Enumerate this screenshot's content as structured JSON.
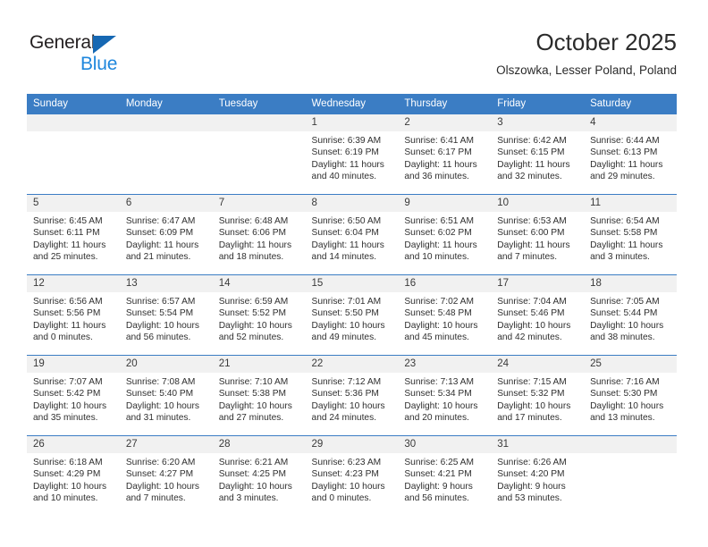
{
  "brand": {
    "name_part1": "General",
    "name_part2": "Blue",
    "triangle_color": "#1668b3",
    "blue_color": "#1f87dd",
    "dark_color": "#231f20"
  },
  "header": {
    "title": "October 2025",
    "subtitle": "Olszowka, Lesser Poland, Poland"
  },
  "theme": {
    "header_blue": "#3b7dc4",
    "daynum_band": "#f1f1f1",
    "text": "#2f2f2f"
  },
  "weekday_headers": [
    "Sunday",
    "Monday",
    "Tuesday",
    "Wednesday",
    "Thursday",
    "Friday",
    "Saturday"
  ],
  "weeks": [
    [
      {
        "day": "",
        "sunrise": "",
        "sunset": "",
        "daylight1": "",
        "daylight2": "",
        "empty": true
      },
      {
        "day": "",
        "sunrise": "",
        "sunset": "",
        "daylight1": "",
        "daylight2": "",
        "empty": true
      },
      {
        "day": "",
        "sunrise": "",
        "sunset": "",
        "daylight1": "",
        "daylight2": "",
        "empty": true
      },
      {
        "day": "1",
        "sunrise": "Sunrise: 6:39 AM",
        "sunset": "Sunset: 6:19 PM",
        "daylight1": "Daylight: 11 hours",
        "daylight2": "and 40 minutes.",
        "empty": false
      },
      {
        "day": "2",
        "sunrise": "Sunrise: 6:41 AM",
        "sunset": "Sunset: 6:17 PM",
        "daylight1": "Daylight: 11 hours",
        "daylight2": "and 36 minutes.",
        "empty": false
      },
      {
        "day": "3",
        "sunrise": "Sunrise: 6:42 AM",
        "sunset": "Sunset: 6:15 PM",
        "daylight1": "Daylight: 11 hours",
        "daylight2": "and 32 minutes.",
        "empty": false
      },
      {
        "day": "4",
        "sunrise": "Sunrise: 6:44 AM",
        "sunset": "Sunset: 6:13 PM",
        "daylight1": "Daylight: 11 hours",
        "daylight2": "and 29 minutes.",
        "empty": false
      }
    ],
    [
      {
        "day": "5",
        "sunrise": "Sunrise: 6:45 AM",
        "sunset": "Sunset: 6:11 PM",
        "daylight1": "Daylight: 11 hours",
        "daylight2": "and 25 minutes.",
        "empty": false
      },
      {
        "day": "6",
        "sunrise": "Sunrise: 6:47 AM",
        "sunset": "Sunset: 6:09 PM",
        "daylight1": "Daylight: 11 hours",
        "daylight2": "and 21 minutes.",
        "empty": false
      },
      {
        "day": "7",
        "sunrise": "Sunrise: 6:48 AM",
        "sunset": "Sunset: 6:06 PM",
        "daylight1": "Daylight: 11 hours",
        "daylight2": "and 18 minutes.",
        "empty": false
      },
      {
        "day": "8",
        "sunrise": "Sunrise: 6:50 AM",
        "sunset": "Sunset: 6:04 PM",
        "daylight1": "Daylight: 11 hours",
        "daylight2": "and 14 minutes.",
        "empty": false
      },
      {
        "day": "9",
        "sunrise": "Sunrise: 6:51 AM",
        "sunset": "Sunset: 6:02 PM",
        "daylight1": "Daylight: 11 hours",
        "daylight2": "and 10 minutes.",
        "empty": false
      },
      {
        "day": "10",
        "sunrise": "Sunrise: 6:53 AM",
        "sunset": "Sunset: 6:00 PM",
        "daylight1": "Daylight: 11 hours",
        "daylight2": "and 7 minutes.",
        "empty": false
      },
      {
        "day": "11",
        "sunrise": "Sunrise: 6:54 AM",
        "sunset": "Sunset: 5:58 PM",
        "daylight1": "Daylight: 11 hours",
        "daylight2": "and 3 minutes.",
        "empty": false
      }
    ],
    [
      {
        "day": "12",
        "sunrise": "Sunrise: 6:56 AM",
        "sunset": "Sunset: 5:56 PM",
        "daylight1": "Daylight: 11 hours",
        "daylight2": "and 0 minutes.",
        "empty": false
      },
      {
        "day": "13",
        "sunrise": "Sunrise: 6:57 AM",
        "sunset": "Sunset: 5:54 PM",
        "daylight1": "Daylight: 10 hours",
        "daylight2": "and 56 minutes.",
        "empty": false
      },
      {
        "day": "14",
        "sunrise": "Sunrise: 6:59 AM",
        "sunset": "Sunset: 5:52 PM",
        "daylight1": "Daylight: 10 hours",
        "daylight2": "and 52 minutes.",
        "empty": false
      },
      {
        "day": "15",
        "sunrise": "Sunrise: 7:01 AM",
        "sunset": "Sunset: 5:50 PM",
        "daylight1": "Daylight: 10 hours",
        "daylight2": "and 49 minutes.",
        "empty": false
      },
      {
        "day": "16",
        "sunrise": "Sunrise: 7:02 AM",
        "sunset": "Sunset: 5:48 PM",
        "daylight1": "Daylight: 10 hours",
        "daylight2": "and 45 minutes.",
        "empty": false
      },
      {
        "day": "17",
        "sunrise": "Sunrise: 7:04 AM",
        "sunset": "Sunset: 5:46 PM",
        "daylight1": "Daylight: 10 hours",
        "daylight2": "and 42 minutes.",
        "empty": false
      },
      {
        "day": "18",
        "sunrise": "Sunrise: 7:05 AM",
        "sunset": "Sunset: 5:44 PM",
        "daylight1": "Daylight: 10 hours",
        "daylight2": "and 38 minutes.",
        "empty": false
      }
    ],
    [
      {
        "day": "19",
        "sunrise": "Sunrise: 7:07 AM",
        "sunset": "Sunset: 5:42 PM",
        "daylight1": "Daylight: 10 hours",
        "daylight2": "and 35 minutes.",
        "empty": false
      },
      {
        "day": "20",
        "sunrise": "Sunrise: 7:08 AM",
        "sunset": "Sunset: 5:40 PM",
        "daylight1": "Daylight: 10 hours",
        "daylight2": "and 31 minutes.",
        "empty": false
      },
      {
        "day": "21",
        "sunrise": "Sunrise: 7:10 AM",
        "sunset": "Sunset: 5:38 PM",
        "daylight1": "Daylight: 10 hours",
        "daylight2": "and 27 minutes.",
        "empty": false
      },
      {
        "day": "22",
        "sunrise": "Sunrise: 7:12 AM",
        "sunset": "Sunset: 5:36 PM",
        "daylight1": "Daylight: 10 hours",
        "daylight2": "and 24 minutes.",
        "empty": false
      },
      {
        "day": "23",
        "sunrise": "Sunrise: 7:13 AM",
        "sunset": "Sunset: 5:34 PM",
        "daylight1": "Daylight: 10 hours",
        "daylight2": "and 20 minutes.",
        "empty": false
      },
      {
        "day": "24",
        "sunrise": "Sunrise: 7:15 AM",
        "sunset": "Sunset: 5:32 PM",
        "daylight1": "Daylight: 10 hours",
        "daylight2": "and 17 minutes.",
        "empty": false
      },
      {
        "day": "25",
        "sunrise": "Sunrise: 7:16 AM",
        "sunset": "Sunset: 5:30 PM",
        "daylight1": "Daylight: 10 hours",
        "daylight2": "and 13 minutes.",
        "empty": false
      }
    ],
    [
      {
        "day": "26",
        "sunrise": "Sunrise: 6:18 AM",
        "sunset": "Sunset: 4:29 PM",
        "daylight1": "Daylight: 10 hours",
        "daylight2": "and 10 minutes.",
        "empty": false
      },
      {
        "day": "27",
        "sunrise": "Sunrise: 6:20 AM",
        "sunset": "Sunset: 4:27 PM",
        "daylight1": "Daylight: 10 hours",
        "daylight2": "and 7 minutes.",
        "empty": false
      },
      {
        "day": "28",
        "sunrise": "Sunrise: 6:21 AM",
        "sunset": "Sunset: 4:25 PM",
        "daylight1": "Daylight: 10 hours",
        "daylight2": "and 3 minutes.",
        "empty": false
      },
      {
        "day": "29",
        "sunrise": "Sunrise: 6:23 AM",
        "sunset": "Sunset: 4:23 PM",
        "daylight1": "Daylight: 10 hours",
        "daylight2": "and 0 minutes.",
        "empty": false
      },
      {
        "day": "30",
        "sunrise": "Sunrise: 6:25 AM",
        "sunset": "Sunset: 4:21 PM",
        "daylight1": "Daylight: 9 hours",
        "daylight2": "and 56 minutes.",
        "empty": false
      },
      {
        "day": "31",
        "sunrise": "Sunrise: 6:26 AM",
        "sunset": "Sunset: 4:20 PM",
        "daylight1": "Daylight: 9 hours",
        "daylight2": "and 53 minutes.",
        "empty": false
      },
      {
        "day": "",
        "sunrise": "",
        "sunset": "",
        "daylight1": "",
        "daylight2": "",
        "empty": true
      }
    ]
  ]
}
